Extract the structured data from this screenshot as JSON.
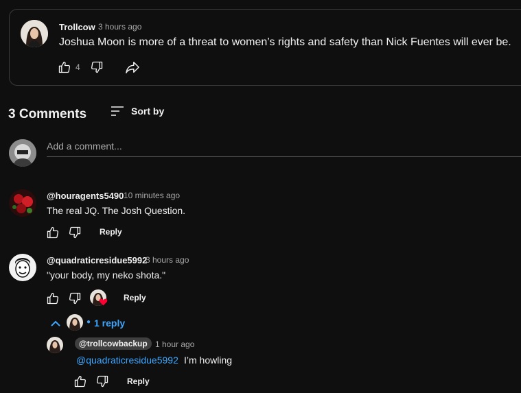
{
  "post": {
    "author": "Trollcow",
    "time": "3 hours ago",
    "text": "Joshua Moon is more of a threat to women’s rights and safety than Nick Fuentes will ever be.",
    "like_count": "4"
  },
  "comments_header": {
    "title": "3 Comments",
    "sort_label": "Sort by"
  },
  "add_comment": {
    "placeholder": "Add a comment..."
  },
  "comments": [
    {
      "author": "@houragents5490",
      "time": "10 minutes ago",
      "text": "The real JQ. The Josh Question.",
      "reply_label": "Reply"
    },
    {
      "author": "@quadraticresidue5992",
      "time": "3 hours ago",
      "text": "\"your body, my neko shota.\"",
      "reply_label": "Reply",
      "replies_toggle": "1 reply"
    }
  ],
  "reply": {
    "author": "@trollcowbackup",
    "time": "1 hour ago",
    "mention": "@quadraticresidue5992",
    "text": "I’m howling",
    "reply_label": "Reply"
  },
  "colors": {
    "background": "#0f0f0f",
    "link_blue": "#3ea6ff",
    "heart_red": "#ff0033"
  }
}
